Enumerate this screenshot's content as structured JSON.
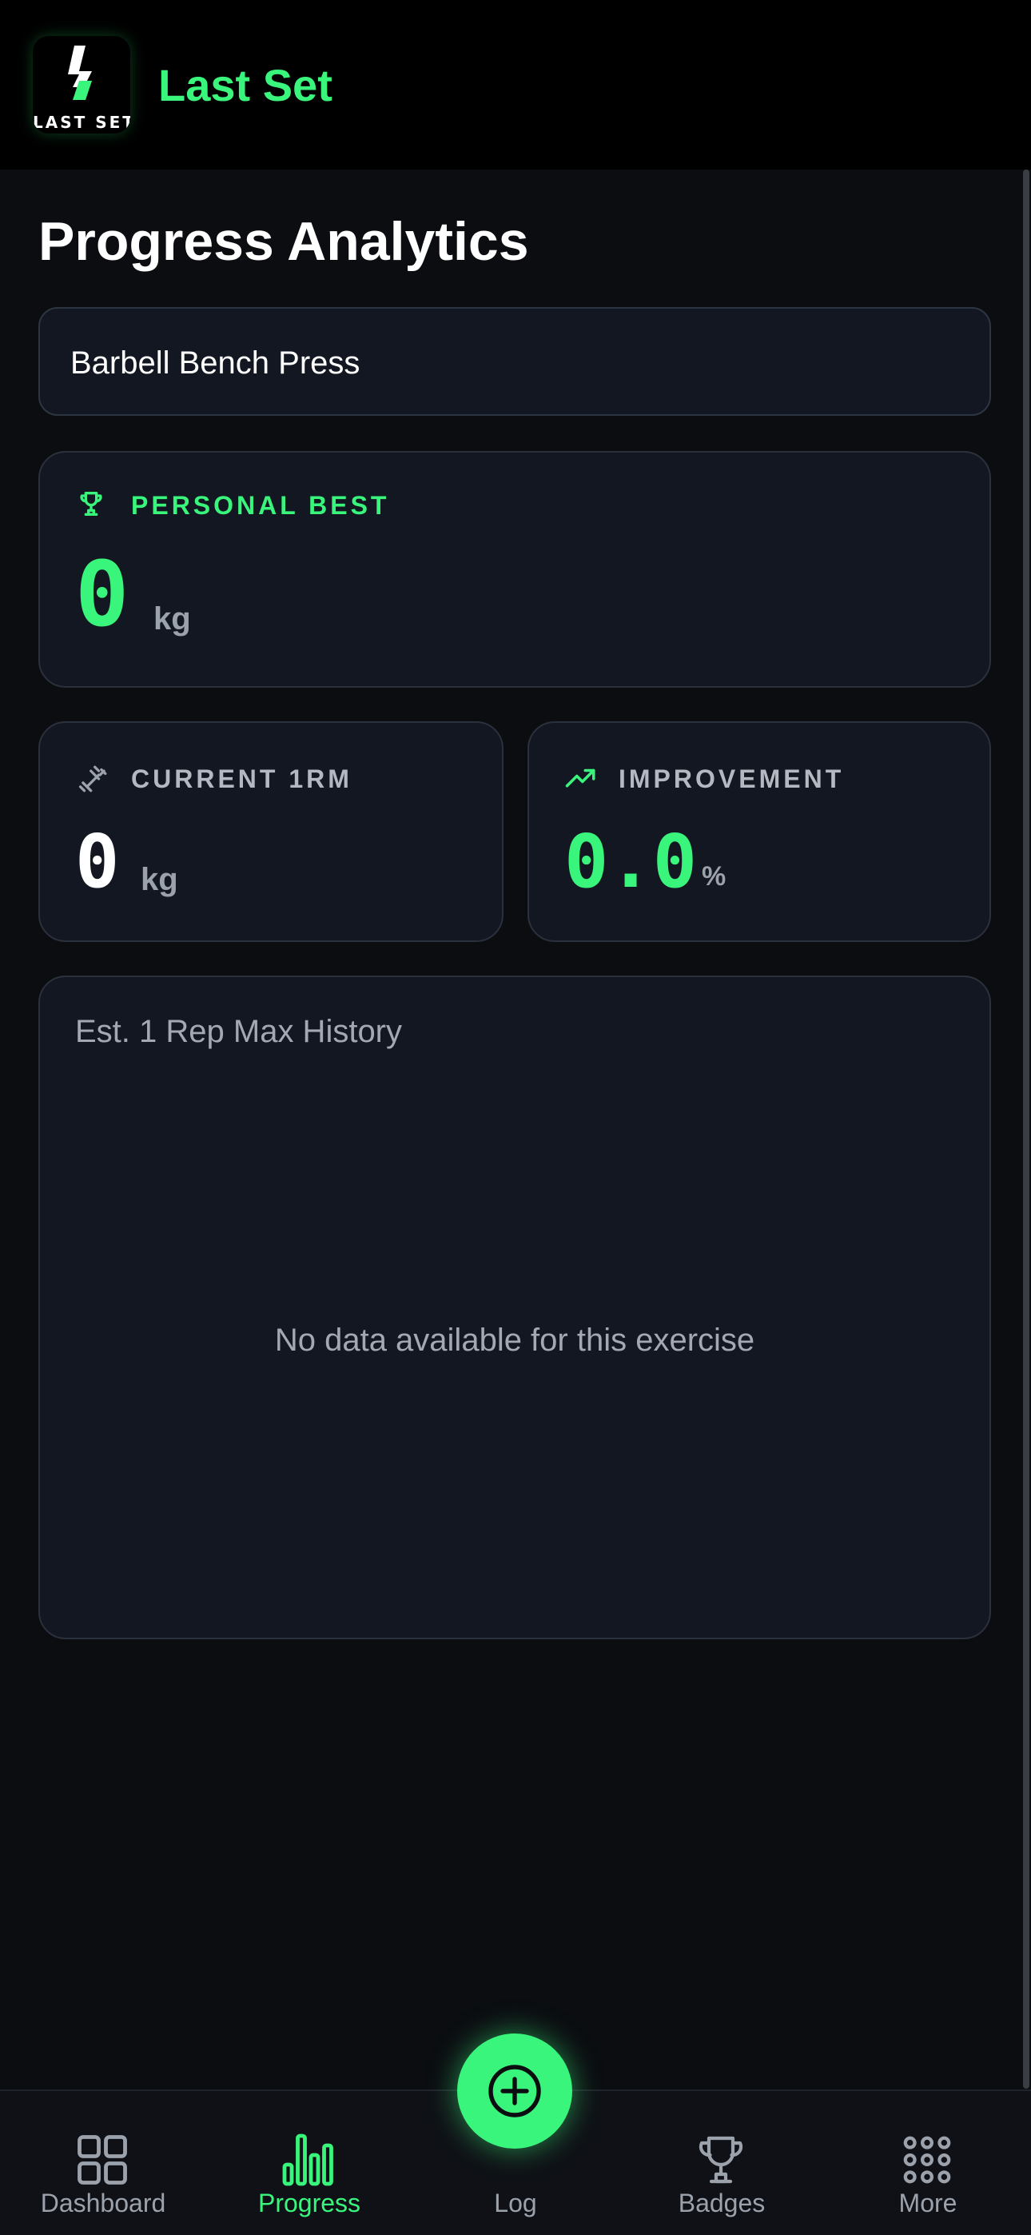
{
  "header": {
    "app_name": "Last Set",
    "logo_text": "LAST SET"
  },
  "page": {
    "title": "Progress Analytics"
  },
  "exercise_select": {
    "value": "Barbell Bench Press"
  },
  "personal_best": {
    "label": "PERSONAL BEST",
    "value": "0",
    "unit": "kg",
    "icon": "trophy-icon"
  },
  "current_1rm": {
    "label": "CURRENT 1RM",
    "value": "0",
    "unit": "kg",
    "icon": "dumbbell-icon"
  },
  "improvement": {
    "label": "IMPROVEMENT",
    "value": "0.0",
    "unit": "%",
    "icon": "trending-up-icon"
  },
  "chart": {
    "title": "Est. 1 Rep Max History",
    "empty_message": "No data available for this exercise"
  },
  "nav": {
    "items": [
      {
        "label": "Dashboard",
        "icon": "grid-icon",
        "active": false
      },
      {
        "label": "Progress",
        "icon": "bar-chart-icon",
        "active": true
      },
      {
        "label": "Log",
        "icon": "plus-circle-icon",
        "active": false
      },
      {
        "label": "Badges",
        "icon": "trophy-icon",
        "active": false
      },
      {
        "label": "More",
        "icon": "dots-grid-icon",
        "active": false
      }
    ]
  },
  "colors": {
    "accent": "#3af57c",
    "background": "#0b0d11",
    "card": "#121722",
    "muted_text": "#9ca2ac"
  }
}
